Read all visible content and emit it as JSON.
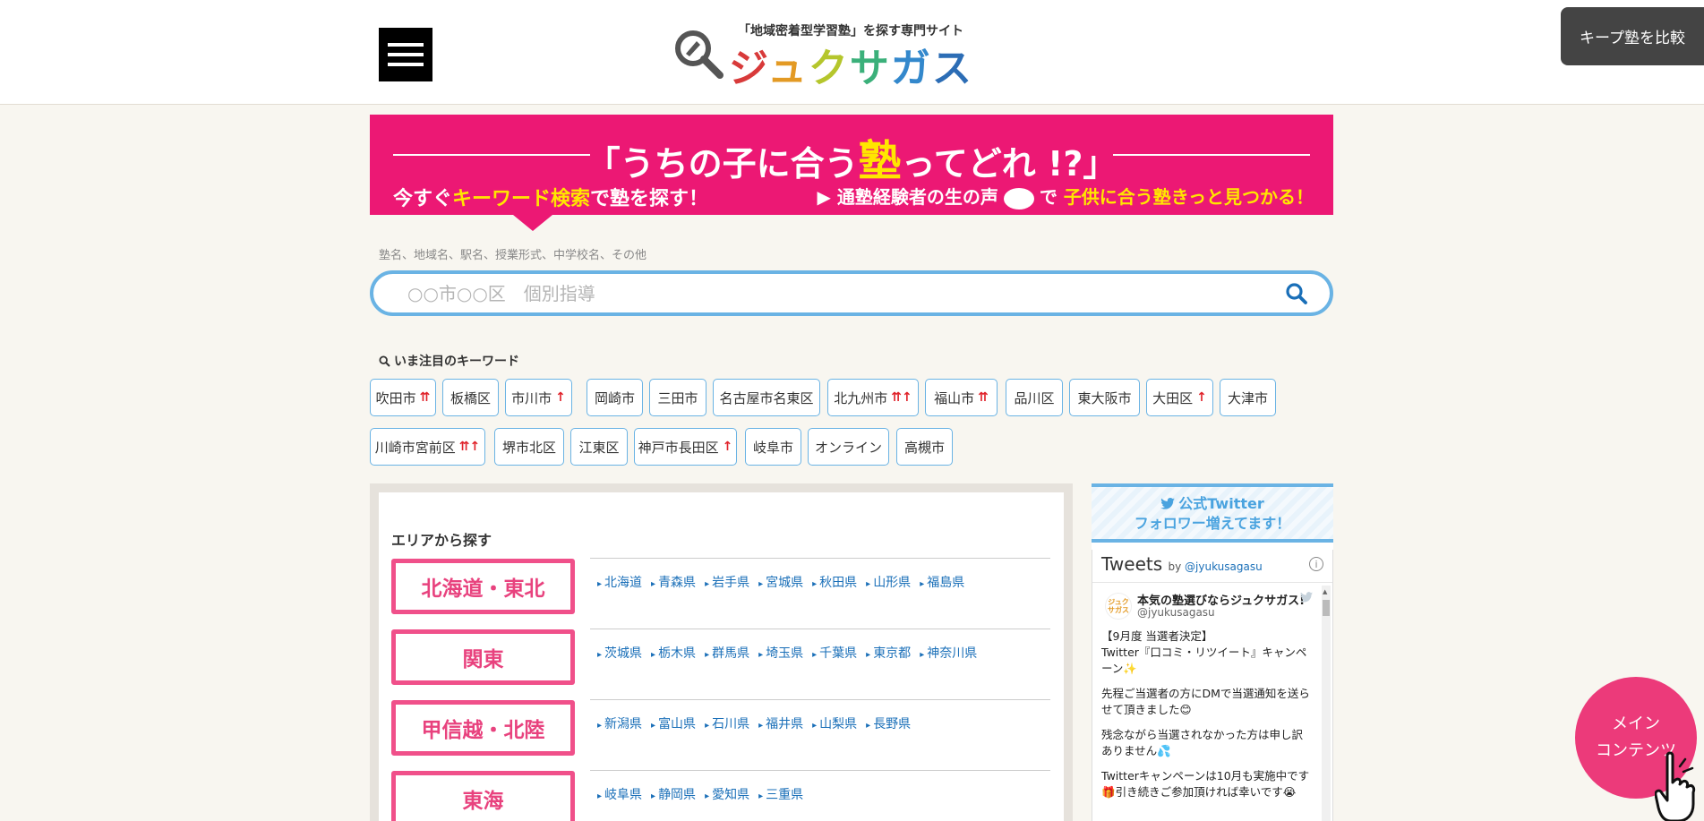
{
  "header": {
    "logo_tagline": "「地域密着型学習塾」を探す専門サイト",
    "logo_chars": [
      "ジ",
      "ュ",
      "ク",
      "サ",
      "ガ",
      "ス"
    ],
    "keep_compare_label": "キープ塾を比較"
  },
  "banner": {
    "title_before": "「うちの子に合う",
    "title_highlight": "塾",
    "title_after": "ってどれ !?」",
    "left_prefix": "今すぐ",
    "left_highlight": "キーワード検索",
    "left_suffix": "で塾を探す！",
    "right_prefix": "▶ 通塾経験者の生の声",
    "right_mid": "で",
    "right_highlight": "子供に合う塾",
    "right_suffix": "きっと見つかる！"
  },
  "search": {
    "hint": "塾名、地域名、駅名、授業形式、中学校名、その他",
    "placeholder": "○○市○○区　個別指導",
    "value": ""
  },
  "keywords": {
    "title": "いま注目のキーワード",
    "items": [
      {
        "label": "吹田市",
        "hot": "⇈"
      },
      {
        "label": "板橋区",
        "hot": ""
      },
      {
        "label": "市川市",
        "hot": "↑"
      },
      {
        "label": "岡崎市",
        "hot": ""
      },
      {
        "label": "三田市",
        "hot": ""
      },
      {
        "label": "名古屋市名東区",
        "hot": ""
      },
      {
        "label": "北九州市",
        "hot": "⇈↑"
      },
      {
        "label": "福山市",
        "hot": "⇈"
      },
      {
        "label": "品川区",
        "hot": ""
      },
      {
        "label": "東大阪市",
        "hot": ""
      },
      {
        "label": "大田区",
        "hot": "↑"
      },
      {
        "label": "大津市",
        "hot": ""
      },
      {
        "label": "川崎市宮前区",
        "hot": "⇈↑"
      },
      {
        "label": "堺市北区",
        "hot": ""
      },
      {
        "label": "江東区",
        "hot": ""
      },
      {
        "label": "神戸市長田区",
        "hot": "↑"
      },
      {
        "label": "岐阜市",
        "hot": ""
      },
      {
        "label": "オンライン",
        "hot": ""
      },
      {
        "label": "高槻市",
        "hot": ""
      }
    ]
  },
  "area": {
    "title": "エリアから探す",
    "regions": [
      {
        "name": "北海道・東北",
        "prefs": [
          "北海道",
          "青森県",
          "岩手県",
          "宮城県",
          "秋田県",
          "山形県",
          "福島県"
        ]
      },
      {
        "name": "関東",
        "prefs": [
          "茨城県",
          "栃木県",
          "群馬県",
          "埼玉県",
          "千葉県",
          "東京都",
          "神奈川県"
        ]
      },
      {
        "name": "甲信越・北陸",
        "prefs": [
          "新潟県",
          "富山県",
          "石川県",
          "福井県",
          "山梨県",
          "長野県"
        ]
      },
      {
        "name": "東海",
        "prefs": [
          "岐阜県",
          "静岡県",
          "愛知県",
          "三重県"
        ]
      }
    ]
  },
  "twitter": {
    "header_line1": "公式Twitter",
    "header_line2": "フォロワー増えてます！",
    "widget_title": "Tweets",
    "by_label": "by",
    "by_handle": "@jyukusagasu",
    "avatar_text": "ジュク サガス",
    "tweet_name": "本気の塾選びならジュクサガス!",
    "tweet_handle": "@jyukusagasu",
    "paragraphs": [
      "【9月度 当選者決定】\nTwitter『口コミ・リツイート』キャンペーン✨",
      "先程ご当選者の方にDMで当選通知を送らせて頂きました😊",
      "残念ながら当選されなかった方は申し訳ありません💦",
      "Twitterキャンペーンは10月も実施中です\n🎁引き続きご参加頂ければ幸いです😭"
    ]
  },
  "floating": {
    "main_content_line1": "メイン",
    "main_content_line2": "コンテンツ"
  },
  "colors": {
    "brand_pink": "#ec1874",
    "accent_blue": "#6ab3e4",
    "region_border": "#f0508a",
    "link_blue": "#1a6fb8",
    "hot_red": "#e0222a"
  }
}
